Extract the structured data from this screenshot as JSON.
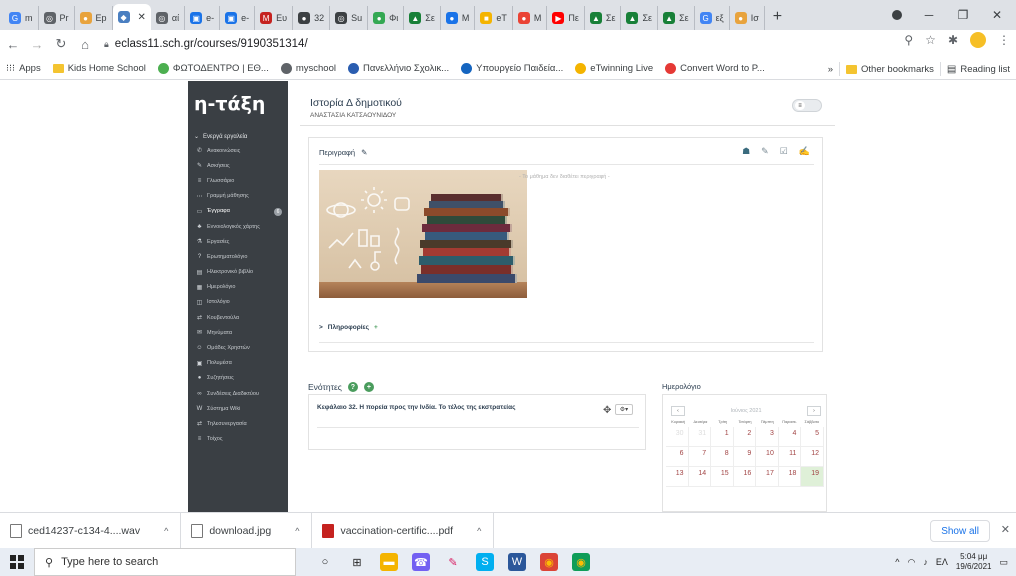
{
  "browser": {
    "tabs": [
      {
        "label": "m",
        "color": "#4285f4",
        "glyph": "G"
      },
      {
        "label": "Pr",
        "color": "#5f6368",
        "glyph": "◎"
      },
      {
        "label": "Ep",
        "color": "#e8a33d",
        "glyph": "●"
      },
      {
        "label": "",
        "color": "#4a7fc1",
        "glyph": "◆",
        "active": true
      },
      {
        "label": "αί",
        "color": "#5f6368",
        "glyph": "◎"
      },
      {
        "label": "e-",
        "color": "#1a73e8",
        "glyph": "▣"
      },
      {
        "label": "e-",
        "color": "#1a73e8",
        "glyph": "▣"
      },
      {
        "label": "Ευ",
        "color": "#c5221f",
        "glyph": "M"
      },
      {
        "label": "32",
        "color": "#3c4043",
        "glyph": "●"
      },
      {
        "label": "Su",
        "color": "#3c4043",
        "glyph": "◎"
      },
      {
        "label": "Φι",
        "color": "#34a853",
        "glyph": "●"
      },
      {
        "label": "Σε",
        "color": "#188038",
        "glyph": "▲"
      },
      {
        "label": "M",
        "color": "#1a73e8",
        "glyph": "●"
      },
      {
        "label": "eT",
        "color": "#f4b400",
        "glyph": "■"
      },
      {
        "label": "M",
        "color": "#ea4335",
        "glyph": "●"
      },
      {
        "label": "Πε",
        "color": "#ff0000",
        "glyph": "▶"
      },
      {
        "label": "Σε",
        "color": "#188038",
        "glyph": "▲"
      },
      {
        "label": "Σε",
        "color": "#188038",
        "glyph": "▲"
      },
      {
        "label": "Σε",
        "color": "#188038",
        "glyph": "▲"
      },
      {
        "label": "εξ",
        "color": "#4285f4",
        "glyph": "G"
      },
      {
        "label": "Ισ",
        "color": "#e8a33d",
        "glyph": "●"
      }
    ],
    "new_tab": "+",
    "url": "eclass11.sch.gr/courses/9190351314/",
    "window_controls": {
      "minimize": "─",
      "maximize": "❐",
      "close": "✕"
    }
  },
  "bookmarks": {
    "items": [
      {
        "label": "Apps",
        "type": "apps"
      },
      {
        "label": "Kids Home School",
        "type": "folder"
      },
      {
        "label": "ΦΩΤΟΔΕΝΤΡΟ | ΕΘ...",
        "type": "site",
        "color": "#4caf50"
      },
      {
        "label": "myschool",
        "type": "site",
        "color": "#5f6368"
      },
      {
        "label": "Πανελλήνιο Σχολικ...",
        "type": "site",
        "color": "#2a5db0"
      },
      {
        "label": "Υπουργείο Παιδεία...",
        "type": "site",
        "color": "#1565c0"
      },
      {
        "label": "eTwinning Live",
        "type": "site",
        "color": "#f4b400"
      },
      {
        "label": "Convert Word to P...",
        "type": "site",
        "color": "#e53935"
      }
    ],
    "overflow": "»",
    "other": "Other bookmarks",
    "reading_list": "Reading list"
  },
  "sidebar": {
    "logo": "η-τάξη",
    "section_title": "Ενεργά εργαλεία",
    "items": [
      {
        "label": "Ανακοινώσεις",
        "icon": "megaphone-icon",
        "glyph": "✆"
      },
      {
        "label": "Ασκήσεις",
        "icon": "edit-icon",
        "glyph": "✎"
      },
      {
        "label": "Γλωσσάριο",
        "icon": "list-icon",
        "glyph": "≡"
      },
      {
        "label": "Γραμμή μάθησης",
        "icon": "ellipsis-icon",
        "glyph": "⋯"
      },
      {
        "label": "Έγγραφα",
        "icon": "folder-icon",
        "glyph": "▭",
        "active": true,
        "badge": "6"
      },
      {
        "label": "Εννοιολογικός χάρτης",
        "icon": "sitemap-icon",
        "glyph": "♣"
      },
      {
        "label": "Εργασίες",
        "icon": "flask-icon",
        "glyph": "⚗"
      },
      {
        "label": "Ερωτηματολόγιο",
        "icon": "question-icon",
        "glyph": "?"
      },
      {
        "label": "Ηλεκτρονικό βιβλίο",
        "icon": "book-icon",
        "glyph": "▤"
      },
      {
        "label": "Ημερολόγιο",
        "icon": "calendar-icon",
        "glyph": "▦"
      },
      {
        "label": "Ιστολόγιο",
        "icon": "columns-icon",
        "glyph": "◫"
      },
      {
        "label": "Κουβεντούλα",
        "icon": "exchange-icon",
        "glyph": "⇄"
      },
      {
        "label": "Μηνύματα",
        "icon": "envelope-icon",
        "glyph": "✉"
      },
      {
        "label": "Ομάδες Χρηστών",
        "icon": "users-icon",
        "glyph": "☺"
      },
      {
        "label": "Πολυμέσα",
        "icon": "film-icon",
        "glyph": "▣"
      },
      {
        "label": "Συζητήσεις",
        "icon": "comments-icon",
        "glyph": "●"
      },
      {
        "label": "Συνδέσεις Διαδικτύου",
        "icon": "link-icon",
        "glyph": "∞"
      },
      {
        "label": "Σύστημα Wiki",
        "icon": "wikipedia-icon",
        "glyph": "W"
      },
      {
        "label": "Τηλεσυνεργασία",
        "icon": "exchange-icon",
        "glyph": "⇄"
      },
      {
        "label": "Τοίχος",
        "icon": "list-icon",
        "glyph": "≡"
      }
    ]
  },
  "course": {
    "title": "Ιστορία Δ δημοτικού",
    "teacher": "ΑΝΑΣΤΑΣΙΑ ΚΑΤΣΑΟΥΝΙΔΟΥ",
    "toggle_icon": "≡"
  },
  "description": {
    "heading": "Περιγραφή",
    "no_description": "- Το μάθημα δεν διαθέτει περιγραφή -",
    "info_label": "Πληροφορίες",
    "info_arrow": ">",
    "info_plus": "+",
    "edit_glyph": "✎",
    "tool_glyphs": [
      "☗",
      "✎",
      "☑",
      "✍"
    ]
  },
  "units": {
    "title": "Ενότητες",
    "help_glyph": "?",
    "add_glyph": "+",
    "items": [
      {
        "title": "Κεφάλαιο 32. Η πορεία προς την Ινδία. Το τέλος της εκστρατείας",
        "move_glyph": "✥",
        "gear_glyph": "⚙▾"
      }
    ]
  },
  "calendar": {
    "title": "Ημερολόγιο",
    "month": "Ιούνιος 2021",
    "prev": "‹",
    "next": "›",
    "dows": [
      "Κυριακή",
      "Δευτέρα",
      "Τρίτη",
      "Τετάρτη",
      "Πέμπτη",
      "Παρασκ.",
      "Σάββατο"
    ],
    "rows": [
      [
        "30",
        "31",
        "1",
        "2",
        "3",
        "4",
        "5"
      ],
      [
        "6",
        "7",
        "8",
        "9",
        "10",
        "11",
        "12"
      ],
      [
        "13",
        "14",
        "15",
        "16",
        "17",
        "18",
        "19"
      ]
    ],
    "other_month": [
      "30",
      "31"
    ],
    "today": "19"
  },
  "downloads": {
    "items": [
      {
        "label": "ced14237-c134-4....wav",
        "type": "file"
      },
      {
        "label": "download.jpg",
        "type": "file"
      },
      {
        "label": "vaccination-certific....pdf",
        "type": "pdf"
      }
    ],
    "show_all": "Show all",
    "close": "✕",
    "caret": "^"
  },
  "taskbar": {
    "search_placeholder": "Type here to search",
    "tray_lang": "ΕΛ",
    "time": "5:04 μμ",
    "date": "19/6/2021",
    "apps": [
      {
        "name": "cortana",
        "glyph": "○",
        "color": "transparent",
        "fg": "#222"
      },
      {
        "name": "task-view",
        "glyph": "⊞",
        "color": "transparent",
        "fg": "#222"
      },
      {
        "name": "file-explorer",
        "glyph": "▬",
        "color": "#f4b400",
        "fg": "#fff"
      },
      {
        "name": "viber",
        "glyph": "☎",
        "color": "#7360f2",
        "fg": "#fff"
      },
      {
        "name": "paint",
        "glyph": "✎",
        "color": "transparent",
        "fg": "#d81b60"
      },
      {
        "name": "skype",
        "glyph": "S",
        "color": "#00aff0",
        "fg": "#fff"
      },
      {
        "name": "word",
        "glyph": "W",
        "color": "#2b579a",
        "fg": "#fff"
      },
      {
        "name": "chrome",
        "glyph": "◉",
        "color": "#db4437",
        "fg": "#fbbc05"
      },
      {
        "name": "chrome-2",
        "glyph": "◉",
        "color": "#0f9d58",
        "fg": "#fbbc05"
      }
    ]
  }
}
